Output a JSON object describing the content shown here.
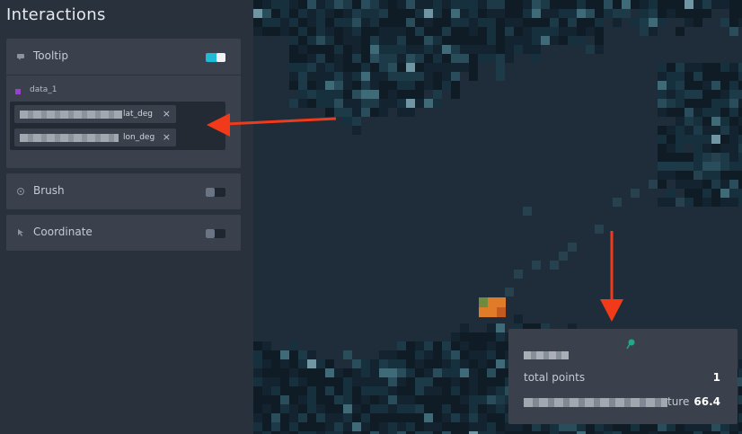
{
  "panel": {
    "title": "Interactions"
  },
  "tooltip_card": {
    "icon": "tooltip-icon",
    "label": "Tooltip",
    "enabled": true,
    "dataset": {
      "name": "data_1",
      "color": "#9b3fcf",
      "fields": [
        {
          "suffix": "lat_deg",
          "remove_glyph": "×"
        },
        {
          "suffix": "lon_deg",
          "remove_glyph": "×"
        }
      ]
    }
  },
  "brush_card": {
    "icon": "brush-icon",
    "label": "Brush",
    "enabled": false
  },
  "coordinate_card": {
    "icon": "coordinate-icon",
    "label": "Coordinate",
    "enabled": false
  },
  "map_tooltip": {
    "pin_icon": "map-pin-icon",
    "pin_color": "#1fa88a",
    "rows": [
      {
        "label": "total points",
        "value": "1"
      },
      {
        "label_suffix": "ture",
        "value": "66.4"
      }
    ]
  },
  "colors": {
    "accent": "#1fbad6",
    "panel_bg": "#29323c",
    "card_bg": "#3a414c",
    "map_bg": "#1e2d39",
    "annotation_arrow": "#f03a1a",
    "highlight_cell": "#e07b2a"
  }
}
